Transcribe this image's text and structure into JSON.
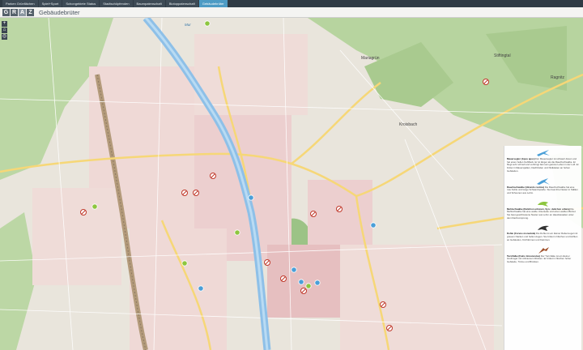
{
  "nav": {
    "tabs": [
      {
        "label": "Parken Grünflächen"
      },
      {
        "label": "Spiel+Sport"
      },
      {
        "label": "Schongebiete Status"
      },
      {
        "label": "Stadtschöpfenden"
      },
      {
        "label": "Baumpatenschaft"
      },
      {
        "label": "Biotoppatenschaft"
      },
      {
        "label": "Gebäudebrüter"
      }
    ],
    "active_index": 6
  },
  "header": {
    "logo_letters": [
      "G",
      "R",
      "A",
      "Z"
    ],
    "title": "Gebäudebrüter"
  },
  "map": {
    "controls": [
      {
        "icon": "plus-icon",
        "symbol": "+"
      },
      {
        "icon": "home-icon",
        "symbol": "⌂"
      },
      {
        "icon": "locate-icon",
        "symbol": "◎"
      }
    ],
    "labels": [
      {
        "text": "Mariagrün"
      },
      {
        "text": "Kroisbach"
      },
      {
        "text": "Stiftingtal"
      },
      {
        "text": "Ragnitz"
      },
      {
        "text": "Mur"
      }
    ],
    "colors": {
      "water": "#9fc8e6",
      "river": "#8ec0e8",
      "forest": "#b9d6a2",
      "urban": "#e8c8c8",
      "major_road": "#f6d777",
      "railway": "#b39a7a",
      "marker_blue": "#4a9fd8",
      "marker_green": "#8dc63f",
      "marker_red": "#c0392b"
    }
  },
  "legend": {
    "entries": [
      {
        "icon": "swift-icon",
        "name": "Mauersegler (Apus apus)",
        "text": "Der Mauersegler ist schwarz-braun und hat einen hellen Kehlfleck. Er ist länger als die Rauchschwalbe. Er fliegt sehr schnell und verbringt fast sein ganzes Leben in der Luft. Er brütet in Mauerspalten, Dachböden und Nistkästen an hohen Gebäuden."
      },
      {
        "icon": "swallow-icon",
        "name": "Rauchschwalbe (Hirundo rustica)",
        "text": "Die Rauchschwalbe hat eine rote Kehle und lange Schwanzspieße. Sie baut ihre Nester in Ställen und Scheunen aus Lehm."
      },
      {
        "icon": "sparrow-icon",
        "name": "Mehlschwalbe (Delichon urbicum, Syn.: delichon urbica)",
        "text": "Die Mehlschwalbe hat eine weiße Unterseite und einen weißen Bürzel. Sie baut geschlossene Nester aus Lehm an Hausfassaden unter dem Dachvorsprung."
      },
      {
        "icon": "jackdaw-icon",
        "name": "Dohle (Corvus monedula)",
        "text": "Die Dohle ist ein kleiner Rabenvogel mit grauem Nacken und hellen Augen. Sie brütet in Nischen und Höhlen an Gebäuden, Kirchtürmen und Kaminen."
      },
      {
        "icon": "kestrel-icon",
        "name": "Turmfalke (Falco tinnunculus)",
        "text": "Der Turmfalke ist ein kleiner Greifvogel mit rotbraunem Rücken. Er brütet in Nischen hoher Gebäude, Türme und Brücken."
      }
    ]
  }
}
